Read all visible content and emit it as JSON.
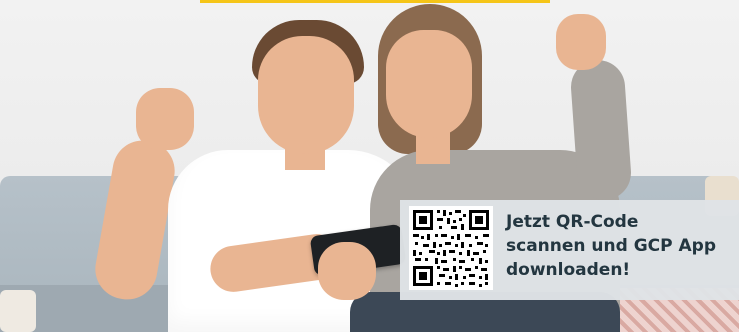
{
  "promo": {
    "line1": "Jetzt QR-Code",
    "line2": "scannen und GCP App",
    "line3": "downloaden!"
  },
  "colors": {
    "accent": "#f5c518",
    "text": "#233640",
    "card": "#dfe3e6"
  },
  "icons": {
    "qr": "qr-code-icon"
  }
}
